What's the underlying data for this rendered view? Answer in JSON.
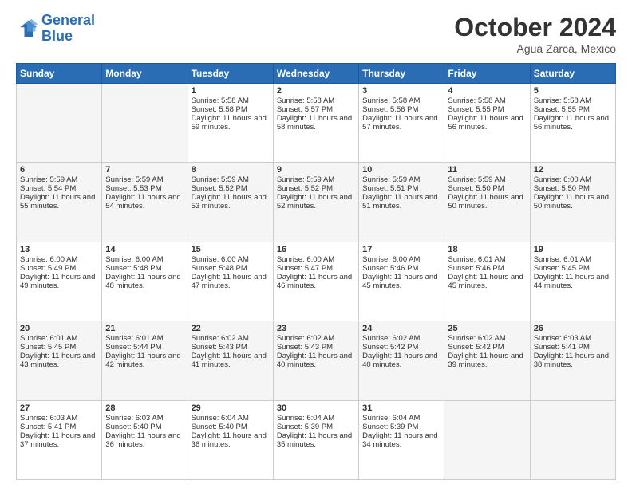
{
  "header": {
    "logo_line1": "General",
    "logo_line2": "Blue",
    "month_year": "October 2024",
    "location": "Agua Zarca, Mexico"
  },
  "days_of_week": [
    "Sunday",
    "Monday",
    "Tuesday",
    "Wednesday",
    "Thursday",
    "Friday",
    "Saturday"
  ],
  "weeks": [
    [
      {
        "day": "",
        "info": ""
      },
      {
        "day": "",
        "info": ""
      },
      {
        "day": "1",
        "info": "Sunrise: 5:58 AM\nSunset: 5:58 PM\nDaylight: 11 hours and 59 minutes."
      },
      {
        "day": "2",
        "info": "Sunrise: 5:58 AM\nSunset: 5:57 PM\nDaylight: 11 hours and 58 minutes."
      },
      {
        "day": "3",
        "info": "Sunrise: 5:58 AM\nSunset: 5:56 PM\nDaylight: 11 hours and 57 minutes."
      },
      {
        "day": "4",
        "info": "Sunrise: 5:58 AM\nSunset: 5:55 PM\nDaylight: 11 hours and 56 minutes."
      },
      {
        "day": "5",
        "info": "Sunrise: 5:58 AM\nSunset: 5:55 PM\nDaylight: 11 hours and 56 minutes."
      }
    ],
    [
      {
        "day": "6",
        "info": "Sunrise: 5:59 AM\nSunset: 5:54 PM\nDaylight: 11 hours and 55 minutes."
      },
      {
        "day": "7",
        "info": "Sunrise: 5:59 AM\nSunset: 5:53 PM\nDaylight: 11 hours and 54 minutes."
      },
      {
        "day": "8",
        "info": "Sunrise: 5:59 AM\nSunset: 5:52 PM\nDaylight: 11 hours and 53 minutes."
      },
      {
        "day": "9",
        "info": "Sunrise: 5:59 AM\nSunset: 5:52 PM\nDaylight: 11 hours and 52 minutes."
      },
      {
        "day": "10",
        "info": "Sunrise: 5:59 AM\nSunset: 5:51 PM\nDaylight: 11 hours and 51 minutes."
      },
      {
        "day": "11",
        "info": "Sunrise: 5:59 AM\nSunset: 5:50 PM\nDaylight: 11 hours and 50 minutes."
      },
      {
        "day": "12",
        "info": "Sunrise: 6:00 AM\nSunset: 5:50 PM\nDaylight: 11 hours and 50 minutes."
      }
    ],
    [
      {
        "day": "13",
        "info": "Sunrise: 6:00 AM\nSunset: 5:49 PM\nDaylight: 11 hours and 49 minutes."
      },
      {
        "day": "14",
        "info": "Sunrise: 6:00 AM\nSunset: 5:48 PM\nDaylight: 11 hours and 48 minutes."
      },
      {
        "day": "15",
        "info": "Sunrise: 6:00 AM\nSunset: 5:48 PM\nDaylight: 11 hours and 47 minutes."
      },
      {
        "day": "16",
        "info": "Sunrise: 6:00 AM\nSunset: 5:47 PM\nDaylight: 11 hours and 46 minutes."
      },
      {
        "day": "17",
        "info": "Sunrise: 6:00 AM\nSunset: 5:46 PM\nDaylight: 11 hours and 45 minutes."
      },
      {
        "day": "18",
        "info": "Sunrise: 6:01 AM\nSunset: 5:46 PM\nDaylight: 11 hours and 45 minutes."
      },
      {
        "day": "19",
        "info": "Sunrise: 6:01 AM\nSunset: 5:45 PM\nDaylight: 11 hours and 44 minutes."
      }
    ],
    [
      {
        "day": "20",
        "info": "Sunrise: 6:01 AM\nSunset: 5:45 PM\nDaylight: 11 hours and 43 minutes."
      },
      {
        "day": "21",
        "info": "Sunrise: 6:01 AM\nSunset: 5:44 PM\nDaylight: 11 hours and 42 minutes."
      },
      {
        "day": "22",
        "info": "Sunrise: 6:02 AM\nSunset: 5:43 PM\nDaylight: 11 hours and 41 minutes."
      },
      {
        "day": "23",
        "info": "Sunrise: 6:02 AM\nSunset: 5:43 PM\nDaylight: 11 hours and 40 minutes."
      },
      {
        "day": "24",
        "info": "Sunrise: 6:02 AM\nSunset: 5:42 PM\nDaylight: 11 hours and 40 minutes."
      },
      {
        "day": "25",
        "info": "Sunrise: 6:02 AM\nSunset: 5:42 PM\nDaylight: 11 hours and 39 minutes."
      },
      {
        "day": "26",
        "info": "Sunrise: 6:03 AM\nSunset: 5:41 PM\nDaylight: 11 hours and 38 minutes."
      }
    ],
    [
      {
        "day": "27",
        "info": "Sunrise: 6:03 AM\nSunset: 5:41 PM\nDaylight: 11 hours and 37 minutes."
      },
      {
        "day": "28",
        "info": "Sunrise: 6:03 AM\nSunset: 5:40 PM\nDaylight: 11 hours and 36 minutes."
      },
      {
        "day": "29",
        "info": "Sunrise: 6:04 AM\nSunset: 5:40 PM\nDaylight: 11 hours and 36 minutes."
      },
      {
        "day": "30",
        "info": "Sunrise: 6:04 AM\nSunset: 5:39 PM\nDaylight: 11 hours and 35 minutes."
      },
      {
        "day": "31",
        "info": "Sunrise: 6:04 AM\nSunset: 5:39 PM\nDaylight: 11 hours and 34 minutes."
      },
      {
        "day": "",
        "info": ""
      },
      {
        "day": "",
        "info": ""
      }
    ]
  ]
}
